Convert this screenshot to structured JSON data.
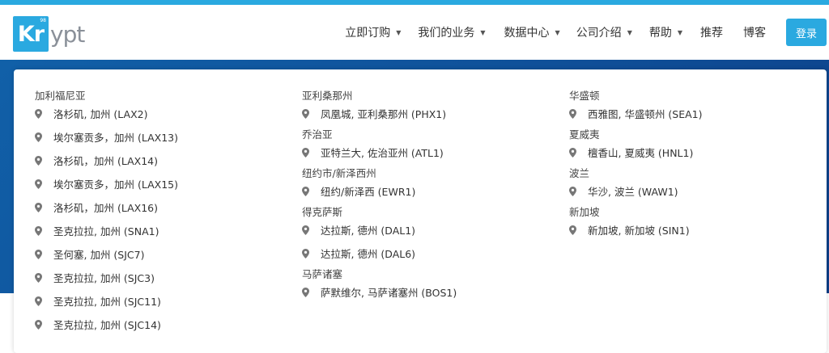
{
  "logo": {
    "prefix": "Kr",
    "suffix": "ypt",
    "superscript": "98"
  },
  "nav": {
    "items": [
      {
        "label": "立即订购",
        "dropdown": true
      },
      {
        "label": "我们的业务",
        "dropdown": true
      },
      {
        "label": "数据中心",
        "dropdown": true
      },
      {
        "label": "公司介绍",
        "dropdown": true
      },
      {
        "label": "帮助",
        "dropdown": true
      },
      {
        "label": "推荐",
        "dropdown": false
      },
      {
        "label": "博客",
        "dropdown": false
      }
    ],
    "login_label": "登录"
  },
  "colors": {
    "accent": "#2aa9e0",
    "banner": "#0f4f98"
  },
  "datacenters": {
    "columns": [
      {
        "groups": [
          {
            "region": "加利福尼亚",
            "locations": [
              "洛杉矶, 加州 (LAX2)",
              "埃尔塞贡多，加州 (LAX13)",
              "洛杉矶，加州 (LAX14)",
              "埃尔塞贡多，加州 (LAX15)",
              "洛杉矶，加州 (LAX16)",
              "圣克拉拉, 加州 (SNA1)",
              "圣何塞, 加州 (SJC7)",
              "圣克拉拉, 加州 (SJC3)",
              "圣克拉拉, 加州 (SJC11)",
              "圣克拉拉, 加州 (SJC14)"
            ]
          }
        ]
      },
      {
        "groups": [
          {
            "region": "亚利桑那州",
            "locations": [
              "凤凰城, 亚利桑那州 (PHX1)"
            ]
          },
          {
            "region": "乔治亚",
            "locations": [
              "亚特兰大, 佐治亚州 (ATL1)"
            ]
          },
          {
            "region": "纽约市/新泽西州",
            "locations": [
              "纽约/新泽西 (EWR1)"
            ]
          },
          {
            "region": "得克萨斯",
            "locations": [
              "达拉斯, 德州 (DAL1)",
              "达拉斯, 德州 (DAL6)"
            ]
          },
          {
            "region": "马萨诸塞",
            "locations": [
              "萨默维尔, 马萨诸塞州 (BOS1)"
            ]
          }
        ]
      },
      {
        "groups": [
          {
            "region": "华盛顿",
            "locations": [
              "西雅图, 华盛顿州 (SEA1)"
            ]
          },
          {
            "region": "夏威夷",
            "locations": [
              "檀香山, 夏威夷 (HNL1)"
            ]
          },
          {
            "region": "波兰",
            "locations": [
              "华沙, 波兰 (WAW1)"
            ]
          },
          {
            "region": "新加坡",
            "locations": [
              "新加坡, 新加坡 (SIN1)"
            ]
          }
        ]
      }
    ]
  }
}
